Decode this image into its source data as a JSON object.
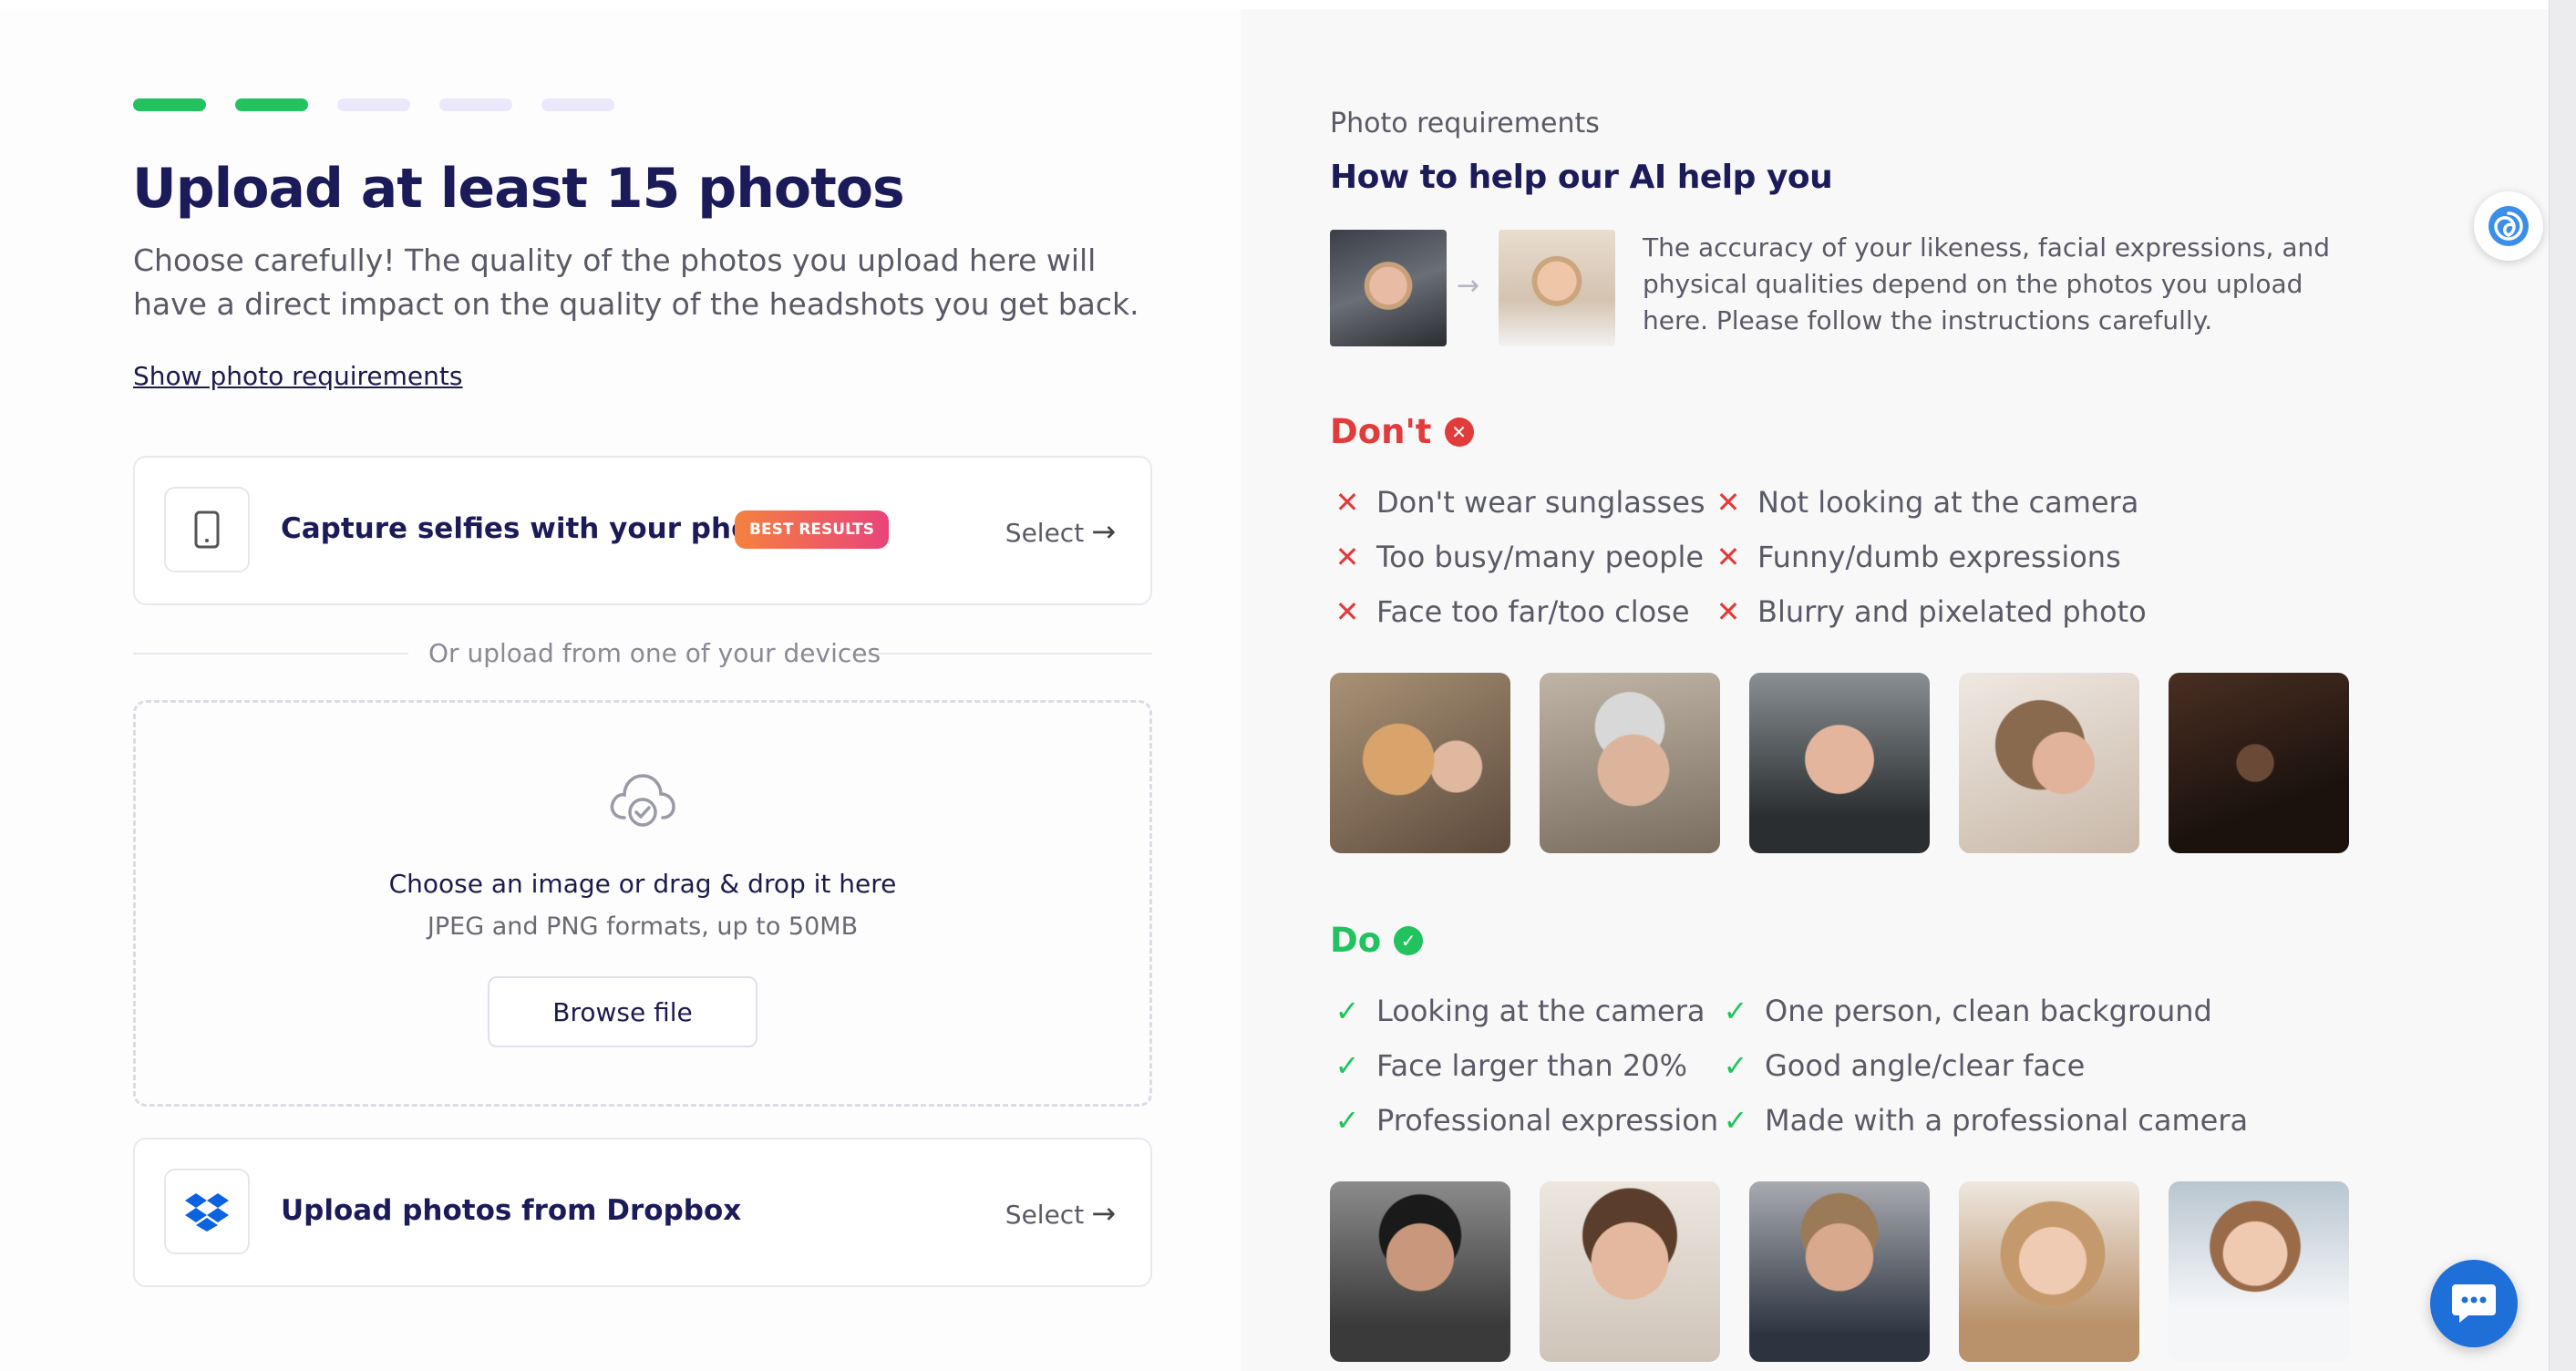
{
  "progress": {
    "total_steps": 5,
    "completed_steps": 2
  },
  "heading": "Upload at least 15 photos",
  "lead": "Choose carefully! The quality of the photos you upload here will have a direct impact on the quality of the headshots you get back.",
  "show_requirements_link": "Show photo requirements",
  "phone_card": {
    "title": "Capture selfies with your phone",
    "badge": "BEST RESULTS",
    "select_label": "Select"
  },
  "divider_text": "Or upload from one of your devices",
  "dropzone": {
    "title": "Choose an image or drag & drop it here",
    "subtitle": "JPEG and PNG formats, up to 50MB",
    "browse_label": "Browse file"
  },
  "dropbox_card": {
    "title": "Upload photos from Dropbox",
    "select_label": "Select"
  },
  "requirements": {
    "pretitle": "Photo requirements",
    "title": "How to help our AI help you",
    "description": "The accuracy of your likeness, facial expressions, and physical qualities depend on the photos you upload here. Please follow the instructions carefully.",
    "dont": {
      "label": "Don't",
      "items": [
        "Don't wear sunglasses",
        "Too busy/many people",
        "Face too far/too close",
        "Not looking at the camera",
        "Funny/dumb expressions",
        "Blurry and pixelated photo"
      ]
    },
    "do": {
      "label": "Do",
      "items": [
        "Looking at the camera",
        "Face larger than 20%",
        "Professional expression",
        "One person, clean background",
        "Good angle/clear face",
        "Made with a professional camera"
      ]
    }
  },
  "colors": {
    "brand_navy": "#1c1b5a",
    "success_green": "#22c35e",
    "error_red": "#e23b3b",
    "chat_blue": "#1f6fd8",
    "badge_gradient": [
      "#f5813f",
      "#e9447a"
    ]
  }
}
